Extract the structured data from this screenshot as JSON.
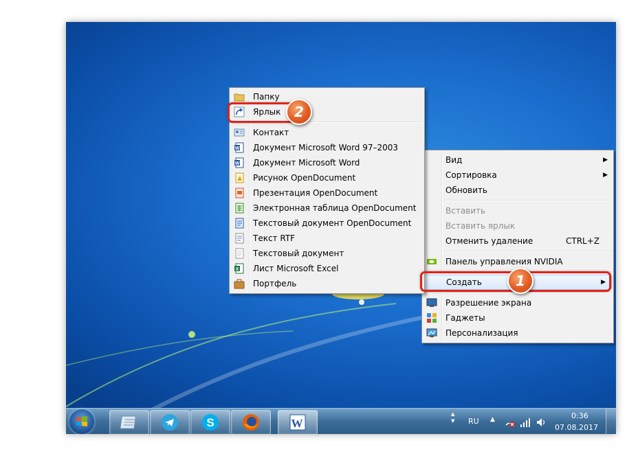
{
  "create_submenu": {
    "items": [
      {
        "label": "Папку",
        "icon": "folder-icon"
      },
      {
        "label": "Ярлык",
        "icon": "shortcut-icon"
      },
      {
        "label": "Контакт",
        "icon": "contact-icon"
      },
      {
        "label": "Документ Microsoft Word 97–2003",
        "icon": "word-doc-icon"
      },
      {
        "label": "Документ Microsoft Word",
        "icon": "word-doc-icon"
      },
      {
        "label": "Рисунок OpenDocument",
        "icon": "odg-icon"
      },
      {
        "label": "Презентация OpenDocument",
        "icon": "odp-icon"
      },
      {
        "label": "Электронная таблица OpenDocument",
        "icon": "ods-icon"
      },
      {
        "label": "Текстовый документ OpenDocument",
        "icon": "odt-icon"
      },
      {
        "label": "Текст RTF",
        "icon": "rtf-icon"
      },
      {
        "label": "Текстовый документ",
        "icon": "txt-icon"
      },
      {
        "label": "Лист Microsoft Excel",
        "icon": "excel-icon"
      },
      {
        "label": "Портфель",
        "icon": "briefcase-icon"
      }
    ]
  },
  "context_menu": {
    "view": "Вид",
    "sort": "Сортировка",
    "refresh": "Обновить",
    "paste": "Вставить",
    "paste_shortcut": "Вставить ярлык",
    "undo_delete": "Отменить удаление",
    "undo_shortcut": "CTRL+Z",
    "nvidia": "Панель управления NVIDIA",
    "create": "Создать",
    "resolution": "Разрешение экрана",
    "gadgets": "Гаджеты",
    "personalization": "Персонализация"
  },
  "callouts": {
    "one": "1",
    "two": "2"
  },
  "taskbar": {
    "apps": [
      "notepad-icon",
      "telegram-icon",
      "skype-icon",
      "firefox-icon",
      "word-icon"
    ],
    "language": "RU",
    "time": "0:36",
    "date": "07.08.2017"
  },
  "colors": {
    "callout_red": "#e2231a",
    "badge_orange": "#e25c23",
    "desktop_blue": "#1a6ccc"
  }
}
